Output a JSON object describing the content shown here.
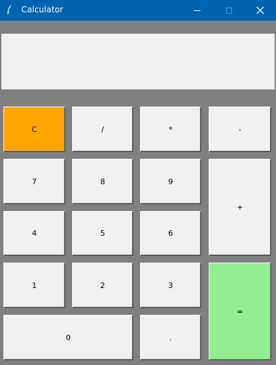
{
  "window": {
    "title": "Calculator",
    "app_icon": "feather-icon",
    "min_icon": "minimize-icon",
    "max_icon": "maximize-icon",
    "close_icon": "close-icon"
  },
  "display": {
    "value": ""
  },
  "keys": {
    "clear": "C",
    "divide": "/",
    "multiply": "*",
    "subtract": "-",
    "seven": "7",
    "eight": "8",
    "nine": "9",
    "add": "+",
    "four": "4",
    "five": "5",
    "six": "6",
    "one": "1",
    "two": "2",
    "three": "3",
    "equals": "=",
    "zero": "0",
    "decimal": "."
  },
  "colors": {
    "titlebar": "#0063b1",
    "background": "#808080",
    "clear_key": "#ffa500",
    "equals_key": "#90ee90",
    "key": "#f0f0f0"
  }
}
